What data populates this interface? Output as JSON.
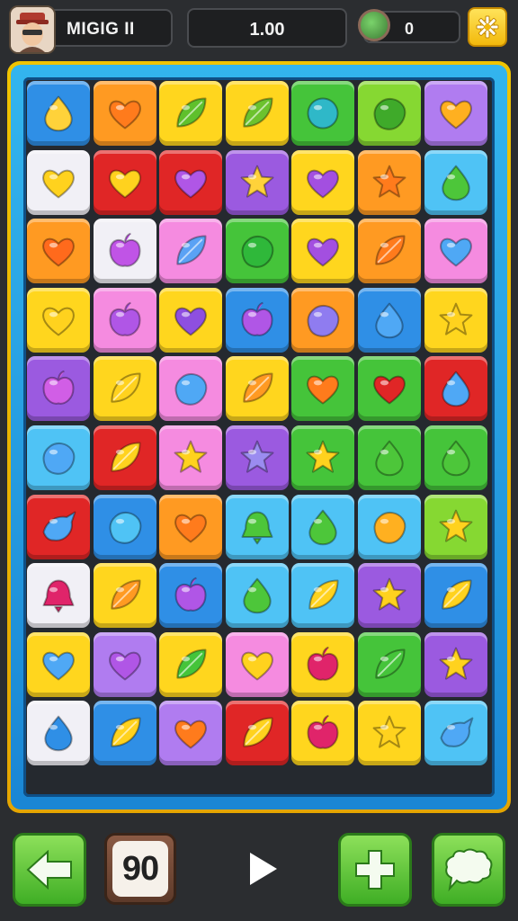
{
  "header": {
    "player_name": "MIGIG II",
    "score": "1.00",
    "coins": "0",
    "avatar_icon": "player-avatar-icon",
    "coin_icon": "coin-icon",
    "settings_icon": "gear-icon"
  },
  "board": {
    "columns": 7,
    "rows": 10,
    "colors": {
      "blue": "#2f8fe6",
      "orange": "#ff9a22",
      "yellow": "#ffd61e",
      "green": "#45c43a",
      "lime": "#86d832",
      "purple": "#9b5ae0",
      "white": "#f1f0f6",
      "red": "#e02626",
      "pink": "#f58be0",
      "sky": "#4fc3f5",
      "violet": "#b07cf0"
    },
    "tiles": [
      [
        [
          "blue",
          "drop",
          "#ffd23a"
        ],
        [
          "orange",
          "heart",
          "#ff7b1c"
        ],
        [
          "yellow",
          "leaf",
          "#5fc02c"
        ],
        [
          "yellow",
          "leaf",
          "#6cc22e"
        ],
        [
          "green",
          "circle",
          "#2fb8c8"
        ],
        [
          "lime",
          "blob",
          "#3faa2a"
        ],
        [
          "violet",
          "heart",
          "#ffb020"
        ]
      ],
      [
        [
          "white",
          "heart",
          "#ffd21e"
        ],
        [
          "red",
          "heart",
          "#ffd21e"
        ],
        [
          "red",
          "heart",
          "#b056e6"
        ],
        [
          "purple",
          "star",
          "#ffd23a"
        ],
        [
          "yellow",
          "heart",
          "#a34fe0"
        ],
        [
          "orange",
          "star",
          "#ff7b1c"
        ],
        [
          "sky",
          "drop",
          "#4dc63a"
        ]
      ],
      [
        [
          "orange",
          "heart",
          "#ff6a1c"
        ],
        [
          "white",
          "apple",
          "#c054e6"
        ],
        [
          "pink",
          "leaf",
          "#5aa2f5"
        ],
        [
          "green",
          "blob",
          "#2fb83a"
        ],
        [
          "yellow",
          "heart",
          "#a34fe0"
        ],
        [
          "orange",
          "leaf",
          "#ff7b1c"
        ],
        [
          "pink",
          "heart",
          "#4fa8f5"
        ]
      ],
      [
        [
          "yellow",
          "heart",
          "#ffd21e"
        ],
        [
          "pink",
          "apple",
          "#b056e6"
        ],
        [
          "yellow",
          "heart",
          "#8e4fe0"
        ],
        [
          "blue",
          "apple",
          "#b056e6"
        ],
        [
          "orange",
          "blob",
          "#8f7cf0"
        ],
        [
          "blue",
          "drop",
          "#4fa8f5"
        ],
        [
          "yellow",
          "star",
          "#ffd21e"
        ]
      ],
      [
        [
          "purple",
          "apple",
          "#d15ee6"
        ],
        [
          "yellow",
          "leaf",
          "#ffd21e"
        ],
        [
          "pink",
          "blob",
          "#4fa8f5"
        ],
        [
          "yellow",
          "leaf",
          "#ff9a22"
        ],
        [
          "green",
          "heart",
          "#ff7b1c"
        ],
        [
          "green",
          "heart",
          "#e02626"
        ],
        [
          "red",
          "drop",
          "#4fa8f5"
        ]
      ],
      [
        [
          "sky",
          "blob",
          "#4fa8f5"
        ],
        [
          "red",
          "leaf",
          "#ffd21e"
        ],
        [
          "pink",
          "star",
          "#ffd21e"
        ],
        [
          "purple",
          "star",
          "#9b8cf0"
        ],
        [
          "green",
          "star",
          "#ffd21e"
        ],
        [
          "green",
          "drop",
          "#4dc63a"
        ],
        [
          "green",
          "drop",
          "#4dc63a"
        ]
      ],
      [
        [
          "red",
          "bird",
          "#4fa8f5"
        ],
        [
          "blue",
          "blob",
          "#4fc3f5"
        ],
        [
          "orange",
          "heart",
          "#ff7b1c"
        ],
        [
          "sky",
          "bell",
          "#4dc63a"
        ],
        [
          "sky",
          "drop",
          "#4dc63a"
        ],
        [
          "sky",
          "blob",
          "#ffb020"
        ],
        [
          "lime",
          "star",
          "#ffd21e"
        ]
      ],
      [
        [
          "white",
          "bell",
          "#e0246a"
        ],
        [
          "yellow",
          "leaf",
          "#ff9a22"
        ],
        [
          "blue",
          "apple",
          "#b056e6"
        ],
        [
          "sky",
          "drop",
          "#4dc63a"
        ],
        [
          "sky",
          "leaf",
          "#ffd21e"
        ],
        [
          "purple",
          "star",
          "#ffd21e"
        ],
        [
          "blue",
          "leaf",
          "#ffd21e"
        ]
      ],
      [
        [
          "yellow",
          "heart",
          "#4fa8f5"
        ],
        [
          "violet",
          "heart",
          "#b056e6"
        ],
        [
          "yellow",
          "leaf",
          "#45c43a"
        ],
        [
          "pink",
          "heart",
          "#ffd21e"
        ],
        [
          "yellow",
          "apple",
          "#e0246a"
        ],
        [
          "green",
          "leaf",
          "#45c43a"
        ],
        [
          "purple",
          "star",
          "#ffd21e"
        ]
      ],
      [
        [
          "white",
          "drop",
          "#2f8fe6"
        ],
        [
          "blue",
          "leaf",
          "#ffd21e"
        ],
        [
          "violet",
          "heart",
          "#ff7b1c"
        ],
        [
          "red",
          "leaf",
          "#ffd21e"
        ],
        [
          "yellow",
          "apple",
          "#e0246a"
        ],
        [
          "yellow",
          "star",
          "#ffd21e"
        ],
        [
          "sky",
          "bird",
          "#4fa8f5"
        ]
      ]
    ]
  },
  "footer": {
    "moves": "90",
    "back_icon": "arrow-left-icon",
    "play_icon": "play-icon",
    "add_icon": "plus-icon",
    "chat_icon": "chat-bubble-icon"
  }
}
